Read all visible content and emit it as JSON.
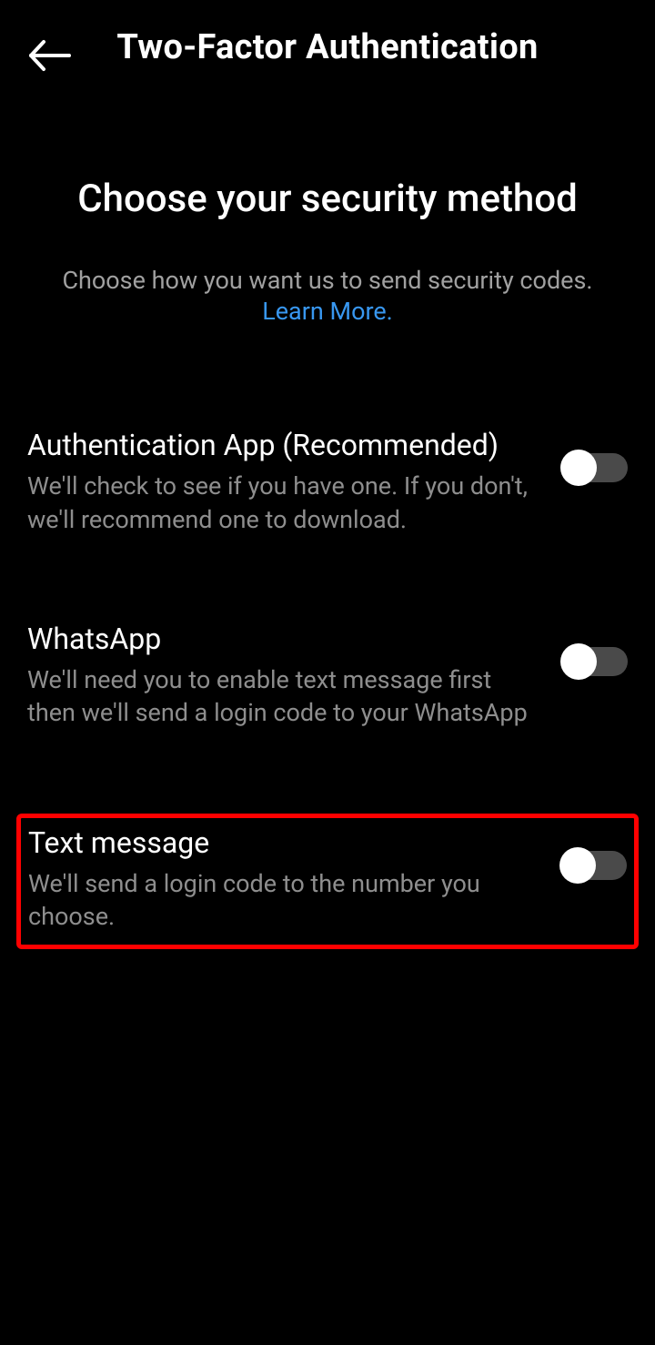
{
  "header": {
    "title": "Two-Factor Authentication"
  },
  "intro": {
    "heading": "Choose your security method",
    "subtext": "Choose how you want us to send security codes.",
    "learn_more": "Learn More."
  },
  "options": [
    {
      "title": "Authentication App (Recommended)",
      "description": "We'll check to see if you have one. If you don't, we'll recommend one to download.",
      "enabled": false,
      "highlighted": false
    },
    {
      "title": "WhatsApp",
      "description": "We'll need you to enable text message first then we'll send a login code to your WhatsApp",
      "enabled": false,
      "highlighted": false
    },
    {
      "title": "Text message",
      "description": "We'll send a login code to the number you choose.",
      "enabled": false,
      "highlighted": true
    }
  ],
  "colors": {
    "link": "#3897f0",
    "highlight": "#ff0000"
  }
}
